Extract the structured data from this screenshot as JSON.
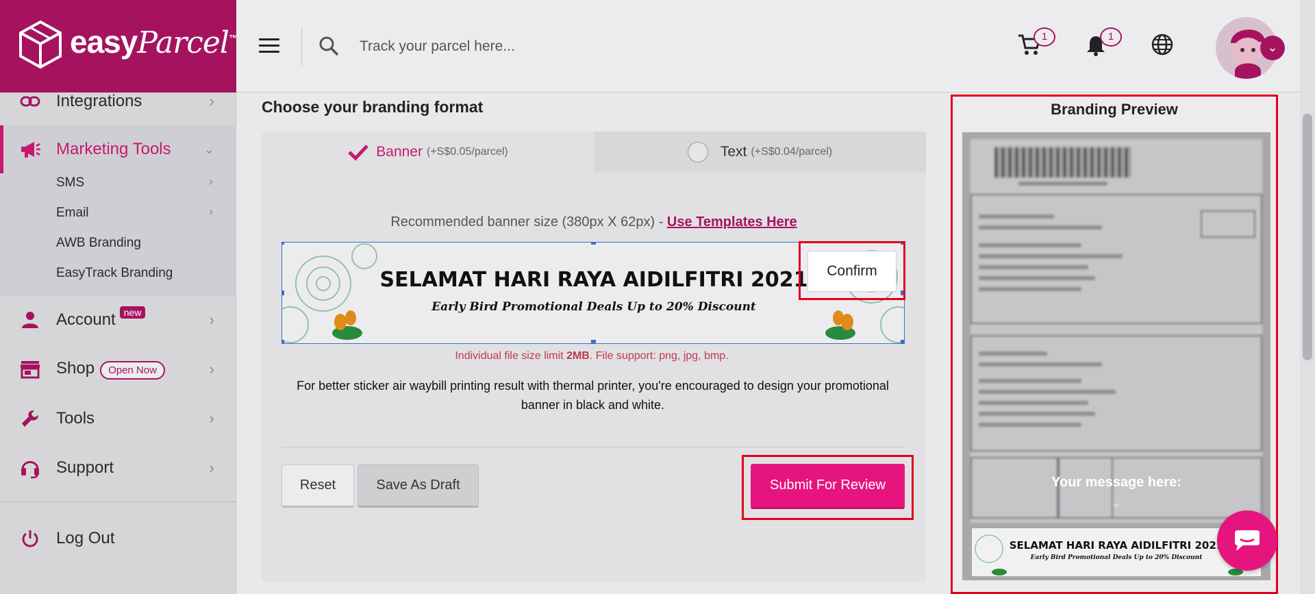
{
  "brand": {
    "name_bold": "easy",
    "name_italic": "Parcel",
    "tm": "™",
    "primary_color": "#a5135f",
    "accent_color": "#e6157e"
  },
  "sidebar": {
    "items": [
      {
        "label": "Integrations",
        "icon": "link-icon"
      },
      {
        "label": "Marketing Tools",
        "icon": "megaphone-icon"
      },
      {
        "label": "Account",
        "icon": "user-icon",
        "badge": "new"
      },
      {
        "label": "Shop",
        "icon": "store-icon",
        "badge": "Open Now"
      },
      {
        "label": "Tools",
        "icon": "wrench-icon"
      },
      {
        "label": "Support",
        "icon": "headset-icon"
      },
      {
        "label": "Log Out",
        "icon": "power-icon"
      }
    ],
    "marketing_sub": [
      {
        "label": "SMS"
      },
      {
        "label": "Email"
      },
      {
        "label": "AWB Branding"
      },
      {
        "label": "EasyTrack Branding"
      }
    ]
  },
  "header": {
    "search_placeholder": "Track your parcel here...",
    "cart_count": "1",
    "notification_count": "1"
  },
  "main": {
    "section_title": "Choose your branding format",
    "tabs": [
      {
        "label": "Banner",
        "price": "(+S$0.05/parcel)",
        "selected": true
      },
      {
        "label": "Text",
        "price": "(+S$0.04/parcel)",
        "selected": false
      }
    ],
    "recommend_text": "Recommended banner size (380px X 62px) -",
    "templates_link": "Use Templates Here",
    "banner": {
      "title": "SELAMAT HARI RAYA AIDILFITRI 2021",
      "subtitle": "Early Bird Promotional Deals Up to 20% Discount"
    },
    "confirm_label": "Confirm",
    "file_limit_prefix": "Individual file size limit",
    "file_limit_size": "2MB",
    "file_limit_suffix": ". File support: png, jpg, bmp.",
    "advice": "For better sticker air waybill printing result with thermal printer, you're encouraged to design your promotional banner in black and white.",
    "reset_label": "Reset",
    "draft_label": "Save As Draft",
    "submit_label": "Submit For Review"
  },
  "preview": {
    "title": "Branding Preview",
    "message_label": "Your message here:"
  }
}
